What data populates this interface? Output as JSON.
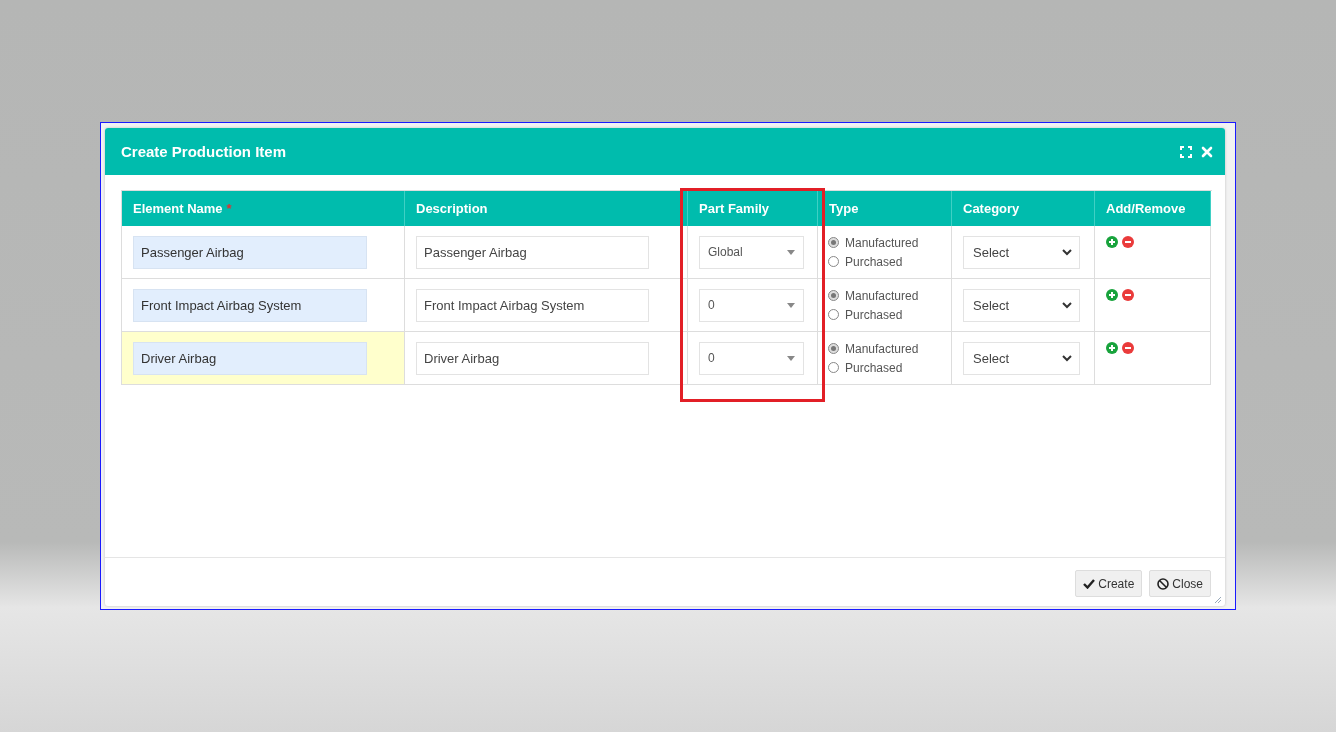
{
  "dialog": {
    "title": "Create Production Item"
  },
  "table": {
    "columns": [
      {
        "label": "Element Name",
        "required_mark": "*",
        "highlighted": false
      },
      {
        "label": "Description",
        "highlighted": false
      },
      {
        "label": "Part Family",
        "highlighted": true
      },
      {
        "label": "Type",
        "highlighted": false
      },
      {
        "label": "Category",
        "highlighted": false
      },
      {
        "label": "Add/Remove",
        "highlighted": false
      }
    ],
    "rows": [
      {
        "element_name": "Passenger Airbag",
        "description": "Passenger Airbag",
        "part_family": "Global",
        "type_options": [
          {
            "label": "Manufactured",
            "selected": true
          },
          {
            "label": "Purchased",
            "selected": false
          }
        ],
        "category": "Select",
        "focused": false
      },
      {
        "element_name": "Front Impact Airbag System",
        "description": "Front Impact Airbag System",
        "part_family": "0",
        "type_options": [
          {
            "label": "Manufactured",
            "selected": true
          },
          {
            "label": "Purchased",
            "selected": false
          }
        ],
        "category": "Select",
        "focused": false
      },
      {
        "element_name": "Driver Airbag",
        "description": "Driver Airbag",
        "part_family": "0",
        "type_options": [
          {
            "label": "Manufactured",
            "selected": true
          },
          {
            "label": "Purchased",
            "selected": false
          }
        ],
        "category": "Select",
        "focused": true
      }
    ]
  },
  "buttons": [
    {
      "label": "Create",
      "kind": "create"
    },
    {
      "label": "Close",
      "kind": "close"
    }
  ]
}
